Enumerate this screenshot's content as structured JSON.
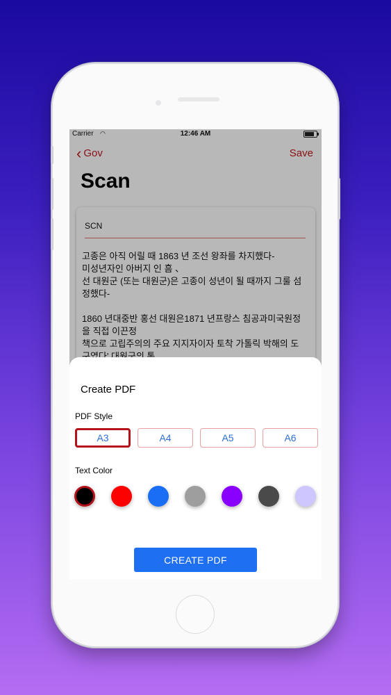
{
  "status": {
    "carrier": "Carrier",
    "time": "12:46 AM",
    "battery_level": 0.9
  },
  "nav": {
    "back_label": "Gov",
    "save_label": "Save"
  },
  "page_title": "Scan",
  "document": {
    "title": "SCN",
    "body": "고종은 아직 어릴 때 1863 년 조선 왕좌를 차지했다-\n미성년자인 아버지 인 흠 、\n선 대원군 (또는 대원군)은 고종이 성년이 될 때까지 그룰 섬정했다-\n\n1860 년대중반 홍선 대원은1871 년프랑스 침공과미국원정을 직접 이끈정\n책으로 고립주의의 주요 지지자이자 토착 가톨릭 박해의 도구였다' 대원군의 통"
  },
  "sheet": {
    "title": "Create PDF",
    "style_label": "PDF Style",
    "styles": [
      "A3",
      "A4",
      "A5",
      "A6"
    ],
    "selected_style": "A3",
    "color_label": "Text Color",
    "colors": [
      "#000000",
      "#ff0000",
      "#1a6ef5",
      "#9e9e9e",
      "#8a00ff",
      "#4a4a4a",
      "#cdc6ff"
    ],
    "selected_color": "#000000",
    "create_label": "CREATE PDF"
  },
  "icons": {
    "back": "chevron-left-icon",
    "wifi": "wifi-icon",
    "battery": "battery-icon"
  }
}
